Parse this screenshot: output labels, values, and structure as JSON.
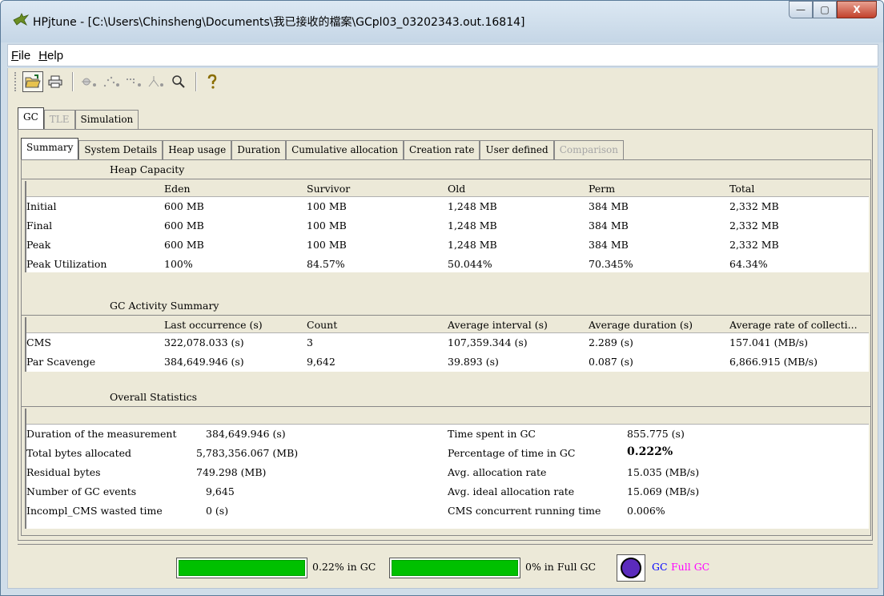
{
  "window": {
    "title": "HPjtune - [C:\\Users\\Chinsheng\\Documents\\我已接收的檔案\\GCpl03_03202343.out.16814]",
    "minimize": "—",
    "maximize": "▢",
    "close": "X"
  },
  "menu": [
    {
      "mnemonic": "F",
      "rest": "ile"
    },
    {
      "mnemonic": "H",
      "rest": "elp"
    }
  ],
  "toolbar": {
    "icons": [
      "open-folder-icon",
      "print-icon",
      "scatter-dots-icon",
      "scatter-line-icon",
      "scatter-bars-icon",
      "axis-plot-icon",
      "zoom-icon",
      "help-icon"
    ]
  },
  "outer_tabs": [
    "GC",
    "TLE",
    "Simulation"
  ],
  "inner_tabs": [
    "Summary",
    "System Details",
    "Heap usage",
    "Duration",
    "Cumulative allocation",
    "Creation rate",
    "User defined",
    "Comparison"
  ],
  "heap_capacity": {
    "title": "Heap Capacity",
    "columns": [
      "",
      "Eden",
      "Survivor",
      "Old",
      "Perm",
      "Total"
    ],
    "rows": [
      [
        "Initial",
        "600 MB",
        "100 MB",
        "1,248 MB",
        "384 MB",
        "2,332 MB"
      ],
      [
        "Final",
        "600 MB",
        "100 MB",
        "1,248 MB",
        "384 MB",
        "2,332 MB"
      ],
      [
        "Peak",
        "600 MB",
        "100 MB",
        "1,248 MB",
        "384 MB",
        "2,332 MB"
      ],
      [
        "Peak Utilization",
        "100%",
        "84.57%",
        "50.044%",
        "70.345%",
        "64.34%"
      ]
    ]
  },
  "gc_activity": {
    "title": "GC Activity Summary",
    "columns": [
      "",
      "Last occurrence (s)",
      "Count",
      "Average interval (s)",
      "Average duration (s)",
      "Average rate of collecti..."
    ],
    "rows": [
      [
        "CMS",
        "322,078.033 (s)",
        "3",
        "107,359.344 (s)",
        "2.289 (s)",
        "157.041 (MB/s)"
      ],
      [
        "Par Scavenge",
        "384,649.946 (s)",
        "9,642",
        "39.893 (s)",
        "0.087 (s)",
        "6,866.915 (MB/s)"
      ]
    ]
  },
  "overall": {
    "title": "Overall Statistics",
    "left": [
      [
        "Duration of the measurement",
        "384,649.946 (s)"
      ],
      [
        "Total bytes allocated",
        "5,783,356.067 (MB)"
      ],
      [
        "Residual bytes",
        "749.298 (MB)"
      ],
      [
        "Number of GC events",
        "9,645"
      ],
      [
        "Incompl_CMS wasted time",
        "0 (s)"
      ]
    ],
    "right": [
      [
        "Time spent in GC",
        "855.775 (s)"
      ],
      [
        "Percentage of time in GC",
        "0.222%"
      ],
      [
        "Avg. allocation rate",
        "15.035 (MB/s)"
      ],
      [
        "Avg. ideal allocation rate",
        "15.069 (MB/s)"
      ],
      [
        "CMS concurrent running time",
        "0.006%"
      ]
    ]
  },
  "status": {
    "gc_bar_label": "0.22% in GC",
    "gc_bar_level": 1.0,
    "full_gc_bar_label": "0% in Full GC",
    "full_gc_bar_level": 1.0,
    "legend_gc": "GC",
    "legend_full_gc": "Full GC",
    "gc_color": "#0000ff",
    "full_gc_color": "#ff00ff",
    "bar_color": "#00c000"
  }
}
